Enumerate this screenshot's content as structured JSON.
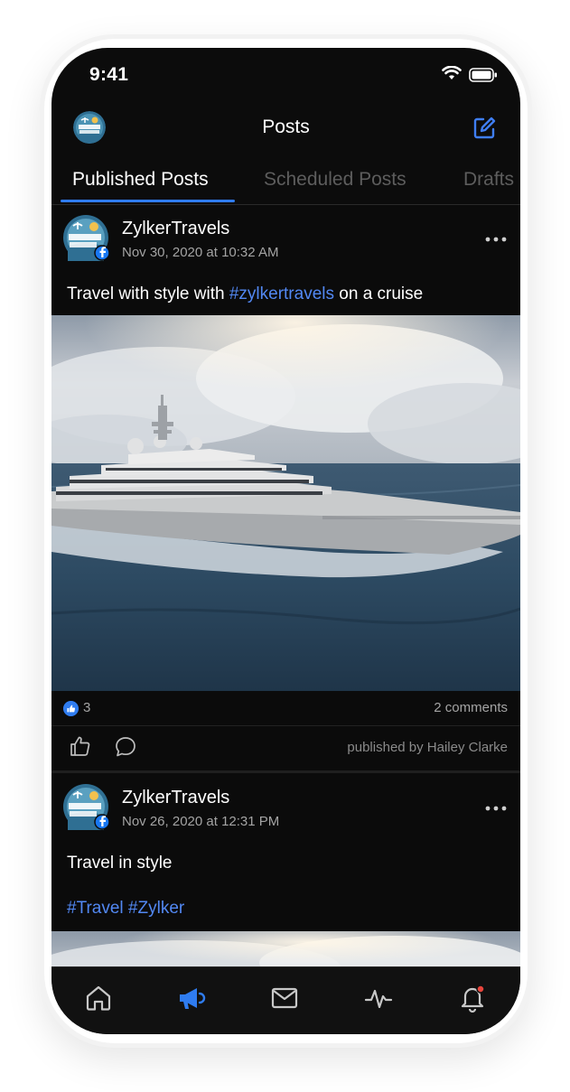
{
  "status_bar": {
    "time": "9:41"
  },
  "header": {
    "title": "Posts",
    "logo_text": "Zylker Travels"
  },
  "tabs": [
    {
      "label": "Published Posts",
      "active": true
    },
    {
      "label": "Scheduled Posts",
      "active": false
    },
    {
      "label": "Drafts",
      "active": false
    }
  ],
  "posts": [
    {
      "author": "ZylkerTravels",
      "date": "Nov 30, 2020 at 10:32 AM",
      "text_before": "Travel with style with ",
      "hashtag": "#zylkertravels",
      "text_after": " on a cruise",
      "likes": "3",
      "comments": "2 comments",
      "published_by": "published by Hailey Clarke"
    },
    {
      "author": "ZylkerTravels",
      "date": "Nov 26, 2020 at 12:31 PM",
      "text": "Travel in style",
      "hashtags": "#Travel #Zylker"
    }
  ],
  "nav": [
    "home-icon",
    "megaphone-icon",
    "mail-icon",
    "activity-icon",
    "bell-icon"
  ],
  "colors": {
    "accent": "#2f7cf0",
    "background": "#0c0c0c",
    "hashtag": "#5288f3",
    "notification": "#e8453c"
  }
}
